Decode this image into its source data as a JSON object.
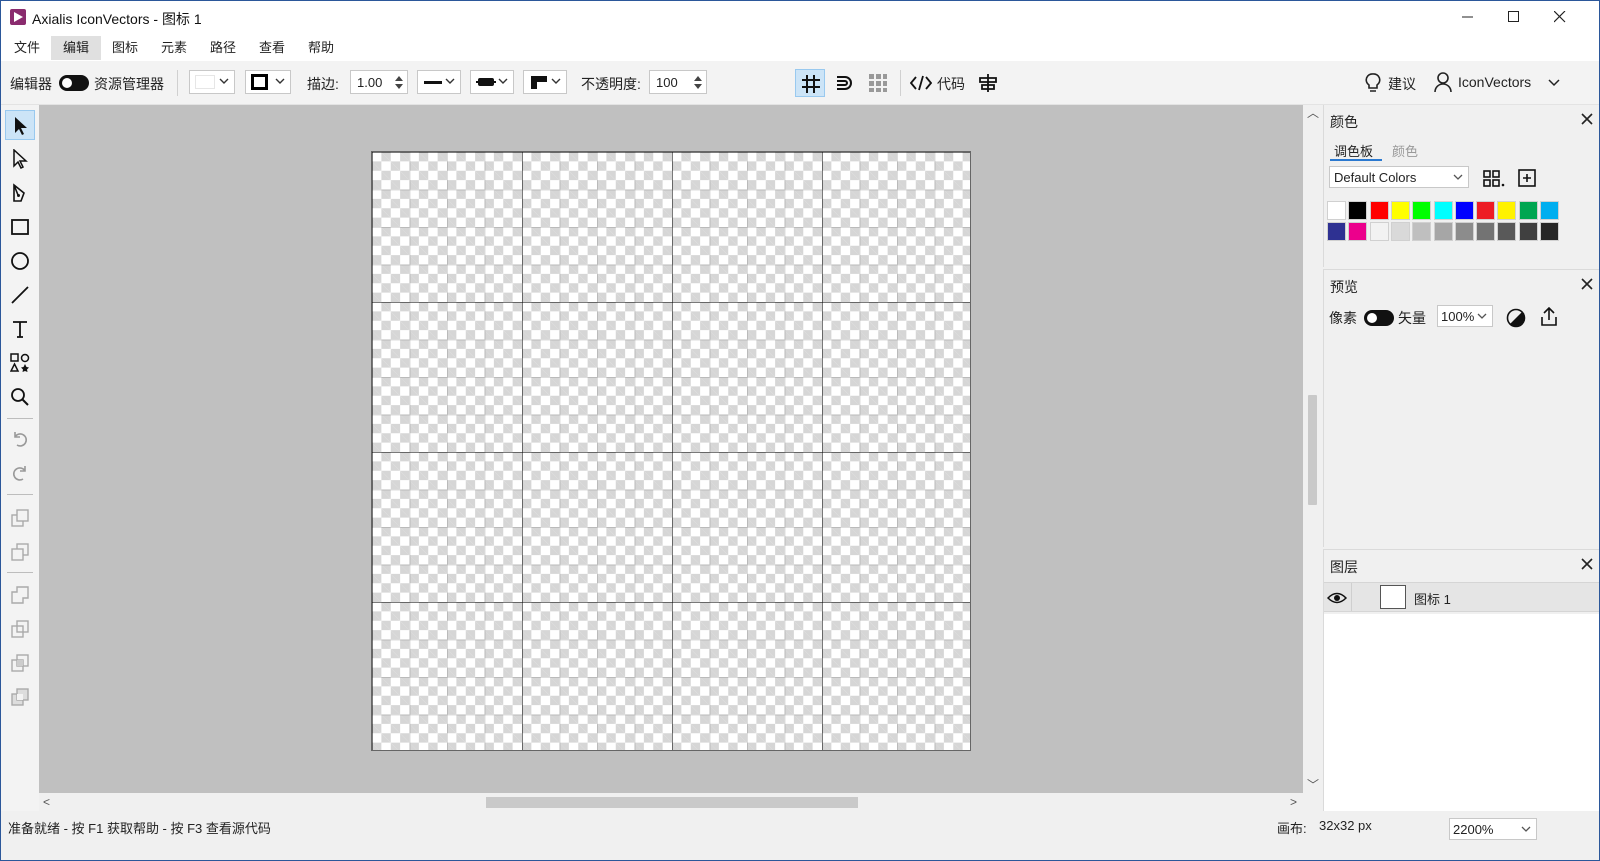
{
  "window": {
    "title": "Axialis IconVectors - 图标 1",
    "minimize": "minimize",
    "maximize": "maximize",
    "close": "close"
  },
  "menu": [
    "文件",
    "编辑",
    "图标",
    "元素",
    "路径",
    "查看",
    "帮助"
  ],
  "menu_active": "编辑",
  "toolbar": {
    "editor_label": "编辑器",
    "explorer_label": "资源管理器",
    "stroke_label": "描边:",
    "stroke_value": "1.00",
    "opacity_label": "不透明度:",
    "opacity_value": "100",
    "code_label": "代码",
    "suggest_label": "建议",
    "account_label": "IconVectors"
  },
  "tools": [
    "select-tool",
    "direct-select-tool",
    "pen-tool",
    "rectangle-tool",
    "ellipse-tool",
    "line-tool",
    "text-tool",
    "shapes-tool",
    "zoom-tool",
    "undo",
    "redo"
  ],
  "colors_panel": {
    "title": "颜色",
    "tab_palette": "调色板",
    "tab_color": "颜色",
    "palette_select": "Default Colors",
    "swatches_row1": [
      "#ffffff",
      "#000000",
      "#ff0000",
      "#ffff00",
      "#00ff00",
      "#00ffff",
      "#0000ff",
      "#ed1c24",
      "#fff200",
      "#00a651",
      "#00aeef"
    ],
    "swatches_row2": [
      "#2e3192",
      "#ec008c",
      "#f2f2f2",
      "#d9d9d9",
      "#bfbfbf",
      "#a6a6a6",
      "#8c8c8c",
      "#737373",
      "#595959",
      "#404040",
      "#262626"
    ]
  },
  "preview_panel": {
    "title": "预览",
    "pixel_label": "像素",
    "vector_label": "矢量",
    "zoom_value": "100%"
  },
  "layers_panel": {
    "title": "图层",
    "layer_name": "图标 1"
  },
  "status": {
    "message": "准备就绪 - 按 F1 获取帮助 - 按 F3 查看源代码",
    "canvas_label": "画布:",
    "canvas_size": "32x32 px",
    "zoom": "2200%"
  }
}
